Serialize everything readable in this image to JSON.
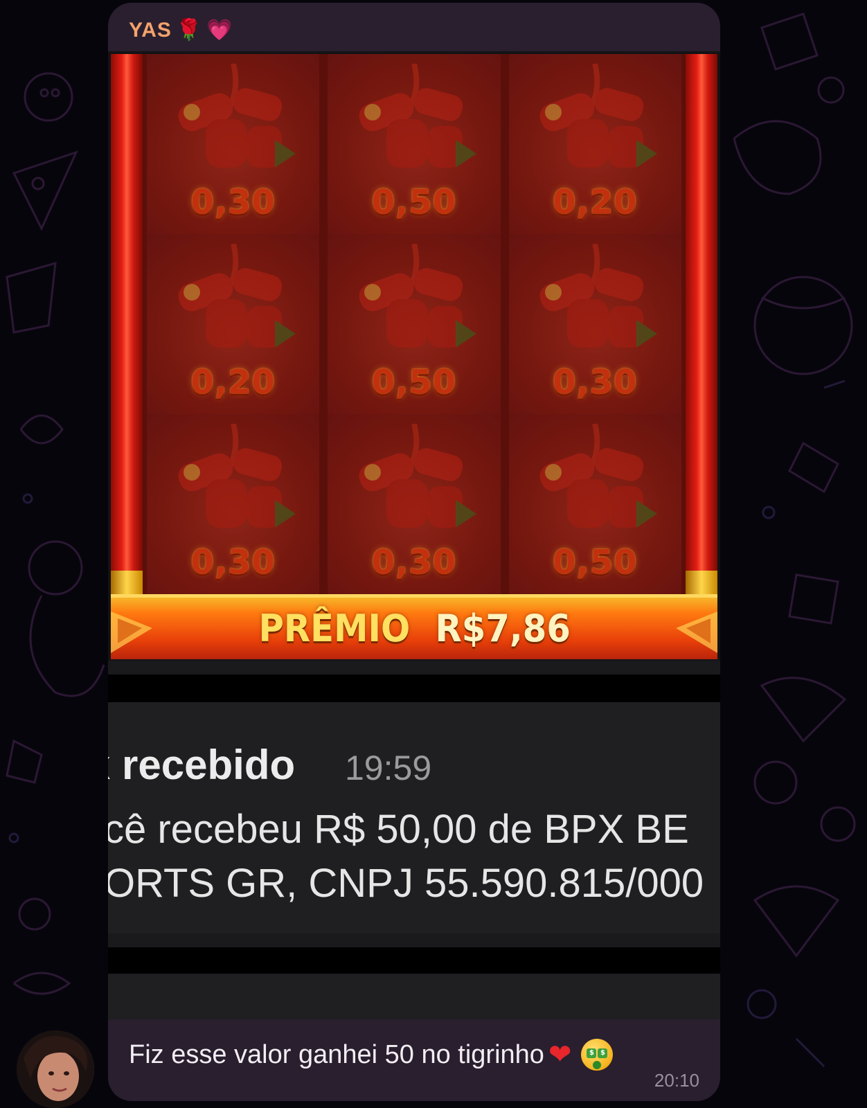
{
  "message": {
    "sender_name": "YAS",
    "sender_emojis": [
      "🌹",
      "💗"
    ],
    "caption_text": "Fiz esse valor ganhei 50 no tigrinho",
    "caption_emojis": [
      "heart-icon",
      "money-mouth-face-icon"
    ],
    "timestamp": "20:10"
  },
  "game": {
    "reels": [
      [
        "0,30",
        "0,50",
        "0,20"
      ],
      [
        "0,20",
        "0,50",
        "0,30"
      ],
      [
        "0,30",
        "0,30",
        "0,50"
      ]
    ],
    "prize_label": "PRÊMIO",
    "prize_amount": "R$7,86"
  },
  "notification": {
    "title": "x recebido",
    "time": "19:59",
    "line1": "cê recebeu R$ 50,00 de BPX BE",
    "line2": "ORTS GR, CNPJ 55.590.815/000"
  },
  "colors": {
    "background": "#07050c",
    "bubble": "#2a1f2e",
    "sender_name": "#f4a36c",
    "prize_text": "#ffe060",
    "timestamp": "#9a8f9c"
  }
}
